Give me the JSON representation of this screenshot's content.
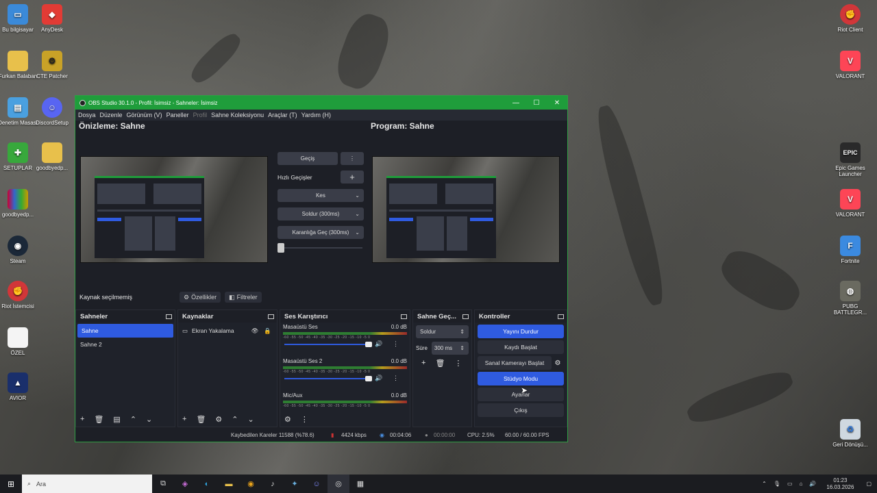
{
  "desktop_icons_left": [
    {
      "label": "Bu bilgisayar",
      "icon": "computer-icon"
    },
    {
      "label": "AnyDesk",
      "icon": "anydesk-icon"
    },
    {
      "label": "Furkan Balaban",
      "icon": "folder-icon"
    },
    {
      "label": "CTE Patcher",
      "icon": "patcher-icon"
    },
    {
      "label": "Denetim Masası",
      "icon": "control-panel-icon"
    },
    {
      "label": "DiscordSetup",
      "icon": "discord-icon"
    },
    {
      "label": "SETUPLAR",
      "icon": "setup-icon"
    },
    {
      "label": "goodbyedp...",
      "icon": "folder-icon"
    },
    {
      "label": "goodbyedp...",
      "icon": "winrar-icon"
    },
    {
      "label": "Steam",
      "icon": "steam-icon"
    },
    {
      "label": "Riot İstemcisi",
      "icon": "riot-icon"
    },
    {
      "label": "ÖZEL",
      "icon": "file-icon"
    },
    {
      "label": "AVIOR",
      "icon": "avior-icon"
    }
  ],
  "desktop_icons_right": [
    {
      "label": "Riot Client",
      "icon": "riot-icon"
    },
    {
      "label": "VALORANT",
      "icon": "valorant-icon"
    },
    {
      "label": "Epic Games Launcher",
      "icon": "epic-icon"
    },
    {
      "label": "VALORANT",
      "icon": "valorant-icon"
    },
    {
      "label": "Fortnite",
      "icon": "fortnite-icon"
    },
    {
      "label": "PUBG BATTLEGR...",
      "icon": "pubg-icon"
    },
    {
      "label": "Geri Dönüşü...",
      "icon": "recycle-bin-icon"
    }
  ],
  "window": {
    "title": "OBS Studio 30.1.0 - Profil: İsimsiz - Sahneler: İsimsiz",
    "minimize": "—",
    "maximize": "☐",
    "close": "✕"
  },
  "menu": [
    "Dosya",
    "Düzenle",
    "Görünüm (V)",
    "Paneller",
    "Profil",
    "Sahne Koleksiyonu",
    "Araçlar (T)",
    "Yardım (H)"
  ],
  "preview_title": "Önizleme: Sahne",
  "program_title": "Program: Sahne",
  "transition": {
    "main_button": "Geçiş",
    "quick_label": "Hızlı Geçişler",
    "items": [
      "Kes",
      "Soldur (300ms)",
      "Karanlığa Geç (300ms)"
    ]
  },
  "source_bar": {
    "status": "Kaynak seçilmemiş",
    "properties": "Özellikler",
    "filters": "Filtreler"
  },
  "scenes": {
    "title": "Sahneler",
    "items": [
      "Sahne",
      "Sahne 2"
    ]
  },
  "sources": {
    "title": "Kaynaklar",
    "items": [
      "Ekran Yakalama"
    ]
  },
  "mixer": {
    "title": "Ses Karıştırıcı",
    "channels": [
      {
        "name": "Masaüstü Ses",
        "db": "0.0 dB"
      },
      {
        "name": "Masaüstü Ses 2",
        "db": "0.0 dB"
      },
      {
        "name": "Mic/Aux",
        "db": "0.0 dB"
      }
    ],
    "scale": "-60 -55 -50 -45 -40 -35 -30 -25 -20 -15 -10 -5 0"
  },
  "scene_transitions": {
    "title": "Sahne Geç...",
    "type": "Soldur",
    "duration_label": "Süre",
    "duration": "300 ms"
  },
  "controls": {
    "title": "Kontroller",
    "stop_stream": "Yayını Durdur",
    "start_record": "Kaydı Başlat",
    "virtual_cam": "Sanal Kamerayı Başlat",
    "studio_mode": "Stüdyo Modu",
    "settings": "Ayarlar",
    "exit": "Çıkış"
  },
  "status": {
    "dropped": "Kaybedilen Kareler 11588 (%78.6)",
    "bitrate": "4424 kbps",
    "stream_time": "00:04:06",
    "rec_time": "00:00:00",
    "cpu": "CPU: 2.5%",
    "fps": "60.00 / 60.00 FPS"
  },
  "taskbar": {
    "search_placeholder": "Ara",
    "time": "01:23",
    "date": "16.03.2026"
  }
}
